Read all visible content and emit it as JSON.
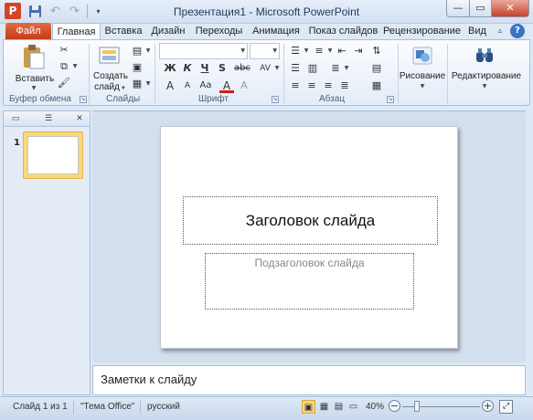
{
  "window": {
    "title": "Презентация1 - Microsoft PowerPoint",
    "app_logo": "P",
    "min_glyph": "—",
    "max_glyph": "▭",
    "close_glyph": "✕"
  },
  "quick_access": {
    "undo_glyph": "↶",
    "redo_glyph": "↷",
    "customize_glyph": "▾"
  },
  "tabs": [
    {
      "label": "Файл"
    },
    {
      "label": "Главная"
    },
    {
      "label": "Вставка"
    },
    {
      "label": "Дизайн"
    },
    {
      "label": "Переходы"
    },
    {
      "label": "Анимация"
    },
    {
      "label": "Показ слайдов"
    },
    {
      "label": "Рецензирование"
    },
    {
      "label": "Вид"
    }
  ],
  "ribbon": {
    "clipboard": {
      "paste": "Вставить",
      "group": "Буфер обмена"
    },
    "slides": {
      "new_slide_1": "Создать",
      "new_slide_2": "слайд",
      "group": "Слайды"
    },
    "font": {
      "group": "Шрифт",
      "bold": "Ж",
      "italic": "К",
      "underline": "Ч",
      "shadow": "S",
      "strike": "abc",
      "spacing": "AV",
      "grow": "A",
      "shrink": "A",
      "case": "Aa",
      "color": "A",
      "clear": "A"
    },
    "paragraph": {
      "group": "Абзац"
    },
    "drawing": {
      "label": "Рисование"
    },
    "editing": {
      "label": "Редактирование"
    }
  },
  "slide_panel": {
    "slide_number": "1"
  },
  "slide": {
    "title_placeholder": "Заголовок слайда",
    "subtitle_placeholder": "Подзаголовок слайда"
  },
  "notes": {
    "placeholder": "Заметки к слайду"
  },
  "status": {
    "slide_info": "Слайд 1 из 1",
    "theme": "\"Тема Office\"",
    "language": "русский",
    "zoom": "40%",
    "zoom_percent": 40
  },
  "colors": {
    "file_tab": "#c13a14",
    "accent": "#3a75c4",
    "selected_thumb": "#f8d979"
  }
}
